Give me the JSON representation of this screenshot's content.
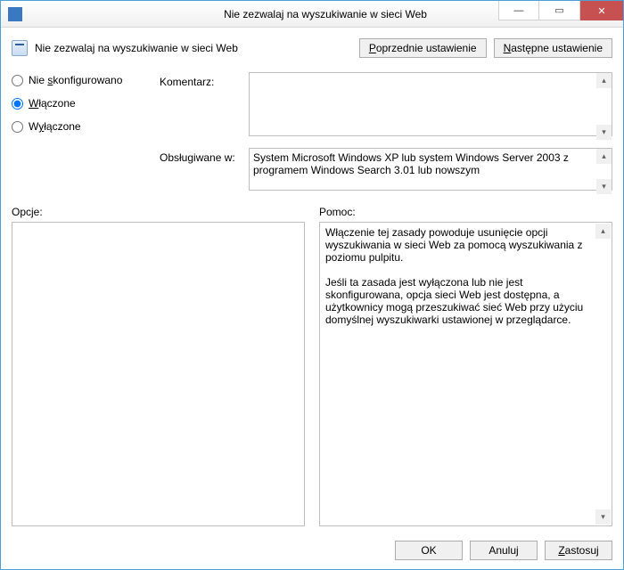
{
  "window": {
    "title": "Nie zezwalaj na wyszukiwanie w sieci Web"
  },
  "header": {
    "policy_title": "Nie zezwalaj na wyszukiwanie w sieci Web",
    "prev_label": "Poprzednie ustawienie",
    "next_label": "Następne ustawienie"
  },
  "radios": {
    "not_configured": "Nie skonfigurowano",
    "enabled": "Włączone",
    "disabled": "Wyłączone",
    "selected": "enabled"
  },
  "fields": {
    "comment_label": "Komentarz:",
    "comment_value": "",
    "supported_label": "Obsługiwane w:",
    "supported_value": "System Microsoft Windows XP lub system Windows Server 2003 z programem Windows Search 3.01 lub nowszym"
  },
  "panels": {
    "options_label": "Opcje:",
    "options_body": "",
    "help_label": "Pomoc:",
    "help_body": "Włączenie tej zasady powoduje usunięcie opcji wyszukiwania w sieci Web za pomocą wyszukiwania z poziomu pulpitu.\n\nJeśli ta zasada jest wyłączona lub nie jest skonfigurowana, opcja sieci Web jest dostępna, a użytkownicy mogą przeszukiwać sieć Web przy użyciu domyślnej wyszukiwarki ustawionej w przeglądarce."
  },
  "footer": {
    "ok": "OK",
    "cancel": "Anuluj",
    "apply": "Zastosuj"
  }
}
